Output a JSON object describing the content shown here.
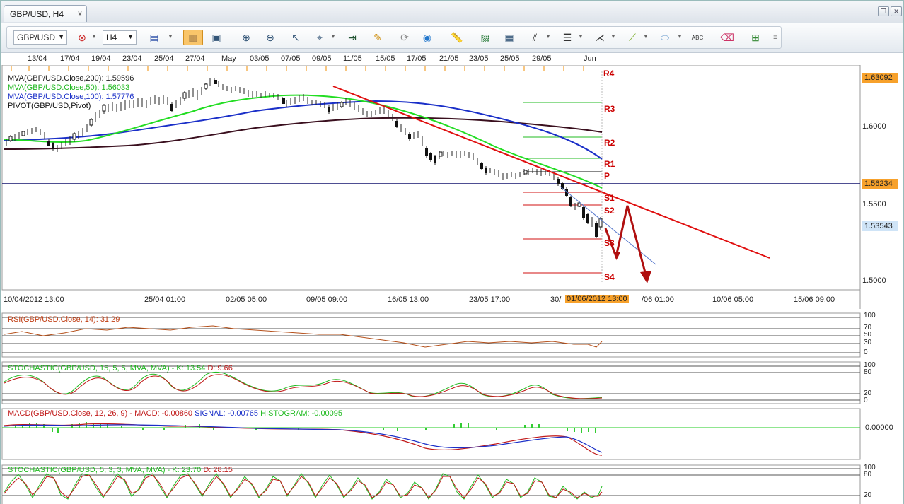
{
  "window": {
    "tab_title": "GBP/USD, H4",
    "close_glyph": "x",
    "restore_glyph": "❐",
    "close_win_glyph": "✕"
  },
  "toolbar": {
    "symbol": "GBP/USD",
    "timeframe": "H4"
  },
  "top_dates": [
    "13/04",
    "17/04",
    "19/04",
    "23/04",
    "25/04",
    "27/04",
    "May",
    "03/05",
    "07/05",
    "09/05",
    "11/05",
    "15/05",
    "17/05",
    "21/05",
    "23/05",
    "25/05",
    "29/05",
    "Jun"
  ],
  "main": {
    "legend": {
      "ma200": "MVA(GBP/USD.Close,200): 1.59596",
      "ma50": "MVA(GBP/USD.Close,50): 1.56033",
      "ma100": "MVA(GBP/USD.Close,100): 1.57776",
      "pivot": "PIVOT(GBP/USD,Pivot)"
    },
    "price_ticks": [
      "1.6000",
      "1.5500",
      "1.5000"
    ],
    "tag_top": "1.63092",
    "tag_line": "1.56234",
    "tag_last": "1.53543",
    "pivot_labels": {
      "r4": "R4",
      "r3": "R3",
      "r2": "R2",
      "r1": "R1",
      "p": "P",
      "s1": "S1",
      "s2": "S2",
      "s3": "S3",
      "s4": "S4"
    },
    "time_labels": [
      "10/04/2012 13:00",
      "25/04 01:00",
      "02/05 05:00",
      "09/05 09:00",
      "16/05 13:00",
      "23/05 17:00",
      "30/",
      "/06 01:00",
      "10/06 05:00",
      "15/06 09:00"
    ],
    "cursor_time": "01/06/2012 13:00"
  },
  "rsi": {
    "legend": "RSI(GBP/USD.Close, 14): 31.29",
    "levels": [
      "100",
      "70",
      "50",
      "30",
      "0"
    ]
  },
  "stoch1": {
    "legend_a": "STOCHASTIC(GBP/USD, 15, 5, 5, MVA, MVA) -",
    "legend_k": "K: 13.54",
    "legend_d": "D: 9.66",
    "levels": [
      "100",
      "80",
      "20",
      "0"
    ]
  },
  "macd": {
    "legend_a": "MACD(GBP/USD.Close, 12, 26, 9) -",
    "legend_macd": "MACD: -0.00860",
    "legend_signal": "SIGNAL: -0.00765",
    "legend_hist": "HISTOGRAM: -0.00095",
    "zero": "0.00000"
  },
  "stoch2": {
    "legend_a": "STOCHASTIC(GBP/USD, 5, 3, 3, MVA, MVA) -",
    "legend_k": "K: 23.70",
    "legend_d": "D: 28.15",
    "levels": [
      "100",
      "80",
      "20"
    ]
  },
  "colors": {
    "ma200": "#3a0f1e",
    "ma50": "#22dd22",
    "ma100": "#1a2fc8",
    "trend": "#e01010",
    "pivot": "#22bb22",
    "support": "#d01010",
    "tag": "#f7a12b",
    "last_tag": "#cfe4f7"
  }
}
